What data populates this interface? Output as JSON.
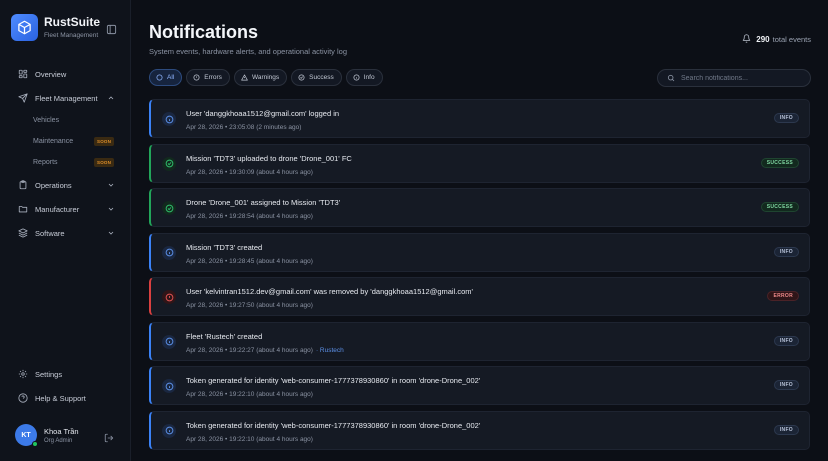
{
  "brand": {
    "name": "RustSuite",
    "subtitle": "Fleet Management"
  },
  "sidebar": {
    "items": [
      {
        "label": "Overview",
        "icon": "grid-icon"
      },
      {
        "label": "Fleet Management",
        "icon": "send-icon",
        "expanded": true,
        "children": [
          {
            "label": "Vehicles",
            "badge": ""
          },
          {
            "label": "Maintenance",
            "badge": "SOON"
          },
          {
            "label": "Reports",
            "badge": "SOON"
          }
        ]
      },
      {
        "label": "Operations",
        "icon": "clipboard-icon"
      },
      {
        "label": "Manufacturer",
        "icon": "folder-icon"
      },
      {
        "label": "Software",
        "icon": "layers-icon"
      }
    ],
    "bottom": [
      {
        "label": "Settings",
        "icon": "gear-icon"
      },
      {
        "label": "Help & Support",
        "icon": "help-icon"
      }
    ],
    "user": {
      "initials": "KT",
      "name": "Khoa Trần",
      "role": "Org Admin"
    }
  },
  "header": {
    "title": "Notifications",
    "subtitle": "System events, hardware alerts, and operational activity log",
    "total_count": "290",
    "total_label": "total events"
  },
  "filters": [
    {
      "label": "All",
      "active": true
    },
    {
      "label": "Errors",
      "active": false
    },
    {
      "label": "Warnings",
      "active": false
    },
    {
      "label": "Success",
      "active": false
    },
    {
      "label": "Info",
      "active": false
    }
  ],
  "search": {
    "placeholder": "Search notifications...",
    "value": ""
  },
  "notifications": [
    {
      "type": "info",
      "message": "User 'danggkhoaa1512@gmail.com' logged in",
      "time": "Apr 28, 2026 • 23:05:08 (2 minutes ago)",
      "link": "",
      "badge": "INFO"
    },
    {
      "type": "success",
      "message": "Mission 'TDT3' uploaded to drone 'Drone_001' FC",
      "time": "Apr 28, 2026 • 19:30:09 (about 4 hours ago)",
      "link": "",
      "badge": "SUCCESS"
    },
    {
      "type": "success",
      "message": "Drone 'Drone_001' assigned to Mission 'TDT3'",
      "time": "Apr 28, 2026 • 19:28:54 (about 4 hours ago)",
      "link": "",
      "badge": "SUCCESS"
    },
    {
      "type": "info",
      "message": "Mission 'TDT3' created",
      "time": "Apr 28, 2026 • 19:28:45 (about 4 hours ago)",
      "link": "",
      "badge": "INFO"
    },
    {
      "type": "error",
      "message": "User 'kelvintran1512.dev@gmail.com' was removed by 'danggkhoaa1512@gmail.com'",
      "time": "Apr 28, 2026 • 19:27:50 (about 4 hours ago)",
      "link": "",
      "badge": "ERROR"
    },
    {
      "type": "info",
      "message": "Fleet 'Rustech' created",
      "time": "Apr 28, 2026 • 19:22:27 (about 4 hours ago)",
      "link": "· Rustech",
      "badge": "INFO"
    },
    {
      "type": "info",
      "message": "Token generated for identity 'web-consumer-1777378930860' in room 'drone-Drone_002'",
      "time": "Apr 28, 2026 • 19:22:10 (about 4 hours ago)",
      "link": "",
      "badge": "INFO"
    },
    {
      "type": "info",
      "message": "Token generated for identity 'web-consumer-1777378930860' in room 'drone-Drone_002'",
      "time": "Apr 28, 2026 • 19:22:10 (about 4 hours ago)",
      "link": "",
      "badge": "INFO"
    }
  ],
  "colors": {
    "accent": "#3b82f6",
    "success": "#22a55a",
    "error": "#d94040",
    "warning": "#e0902a",
    "background": "#0c0f16"
  }
}
